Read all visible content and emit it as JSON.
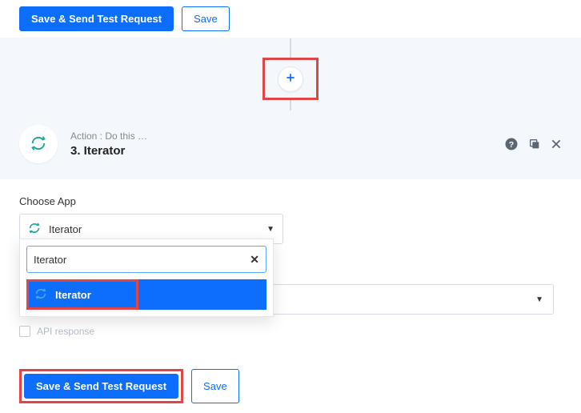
{
  "top": {
    "save_send": "Save & Send Test Request",
    "save": "Save"
  },
  "step": {
    "action_line": "Action : Do this …",
    "title": "3. Iterator"
  },
  "choose_app": {
    "label": "Choose App",
    "selected": "Iterator",
    "search_value": "Iterator",
    "option": "Iterator"
  },
  "obscured": {
    "text": "API response"
  },
  "bottom": {
    "save_send": "Save & Send Test Request",
    "save": "Save"
  }
}
